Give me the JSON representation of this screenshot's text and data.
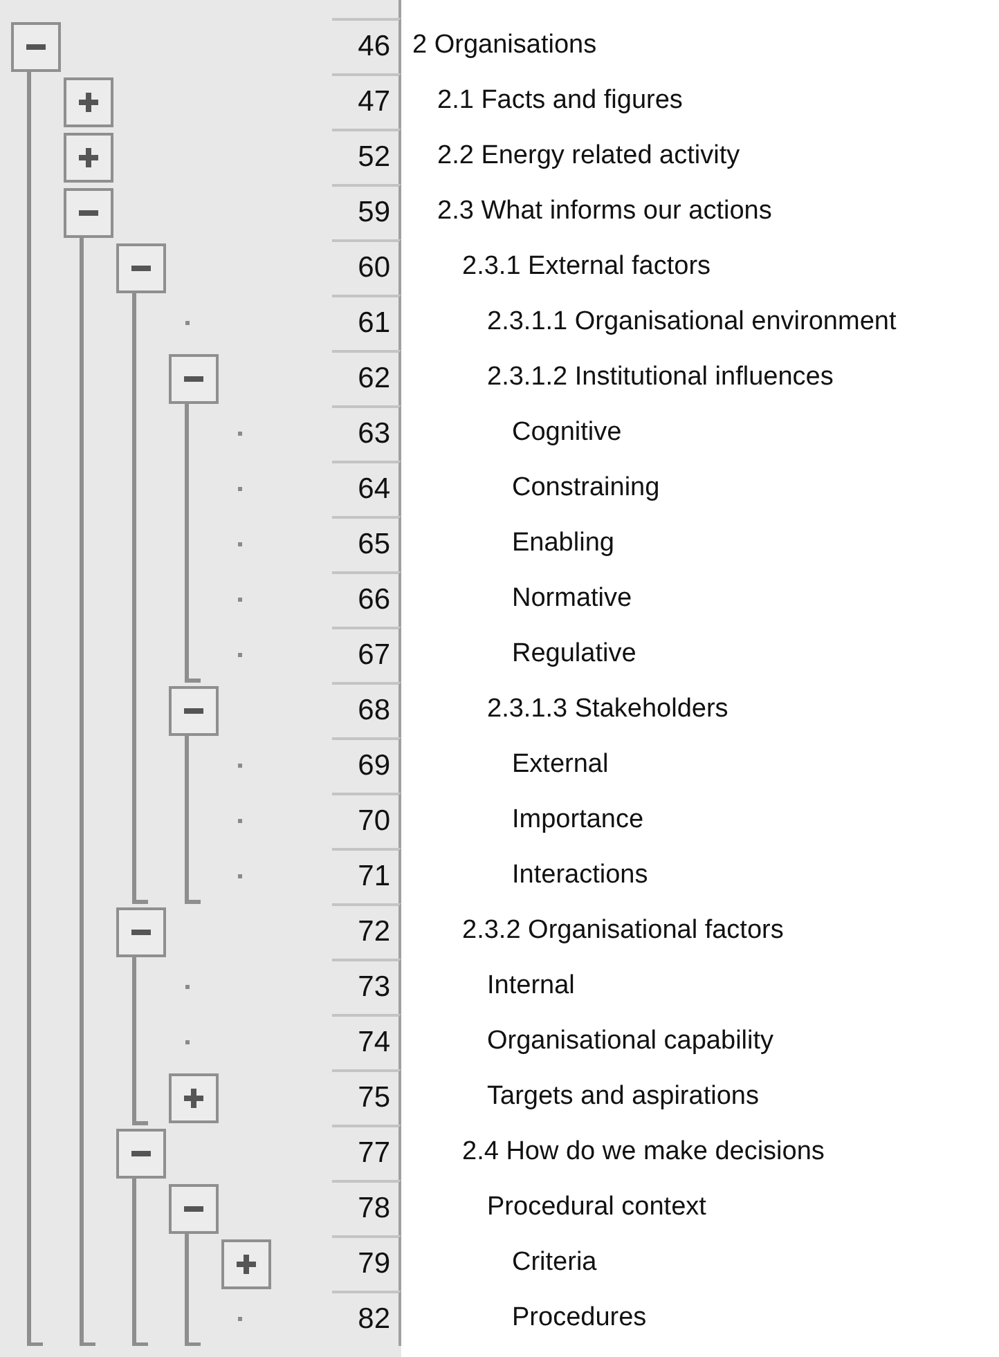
{
  "outline": {
    "nodes": [
      {
        "number": "46",
        "label": "2 Organisations",
        "expanded": true,
        "children": [
          {
            "number": "47",
            "label": "2.1 Facts and figures",
            "expanded": false
          },
          {
            "number": "52",
            "label": "2.2  Energy related activity",
            "expanded": false
          },
          {
            "number": "59",
            "label": "2.3 What informs our actions",
            "expanded": true,
            "children": [
              {
                "number": "60",
                "label": "2.3.1 External factors",
                "expanded": true,
                "children": [
                  {
                    "number": "61",
                    "label": "2.3.1.1 Organisational environment"
                  },
                  {
                    "number": "62",
                    "label": "2.3.1.2 Institutional influences",
                    "expanded": true,
                    "children": [
                      {
                        "number": "63",
                        "label": "Cognitive"
                      },
                      {
                        "number": "64",
                        "label": "Constraining"
                      },
                      {
                        "number": "65",
                        "label": "Enabling"
                      },
                      {
                        "number": "66",
                        "label": "Normative"
                      },
                      {
                        "number": "67",
                        "label": "Regulative"
                      }
                    ]
                  },
                  {
                    "number": "68",
                    "label": "2.3.1.3 Stakeholders",
                    "expanded": true,
                    "children": [
                      {
                        "number": "69",
                        "label": "External"
                      },
                      {
                        "number": "70",
                        "label": "Importance"
                      },
                      {
                        "number": "71",
                        "label": "Interactions"
                      }
                    ]
                  }
                ]
              },
              {
                "number": "72",
                "label": "2.3.2 Organisational factors",
                "expanded": true,
                "children": [
                  {
                    "number": "73",
                    "label": "Internal"
                  },
                  {
                    "number": "74",
                    "label": "Organisational capability"
                  },
                  {
                    "number": "75",
                    "label": "Targets and aspirations",
                    "expanded": false
                  }
                ]
              },
              {
                "number": "77",
                "label": "2.4 How do we make decisions",
                "expanded": true,
                "children": [
                  {
                    "number": "78",
                    "label": "Procedural context",
                    "expanded": true,
                    "children": [
                      {
                        "number": "79",
                        "label": "Criteria",
                        "expanded": false
                      },
                      {
                        "number": "82",
                        "label": "Procedures"
                      }
                    ]
                  }
                ]
              }
            ]
          }
        ]
      }
    ]
  }
}
